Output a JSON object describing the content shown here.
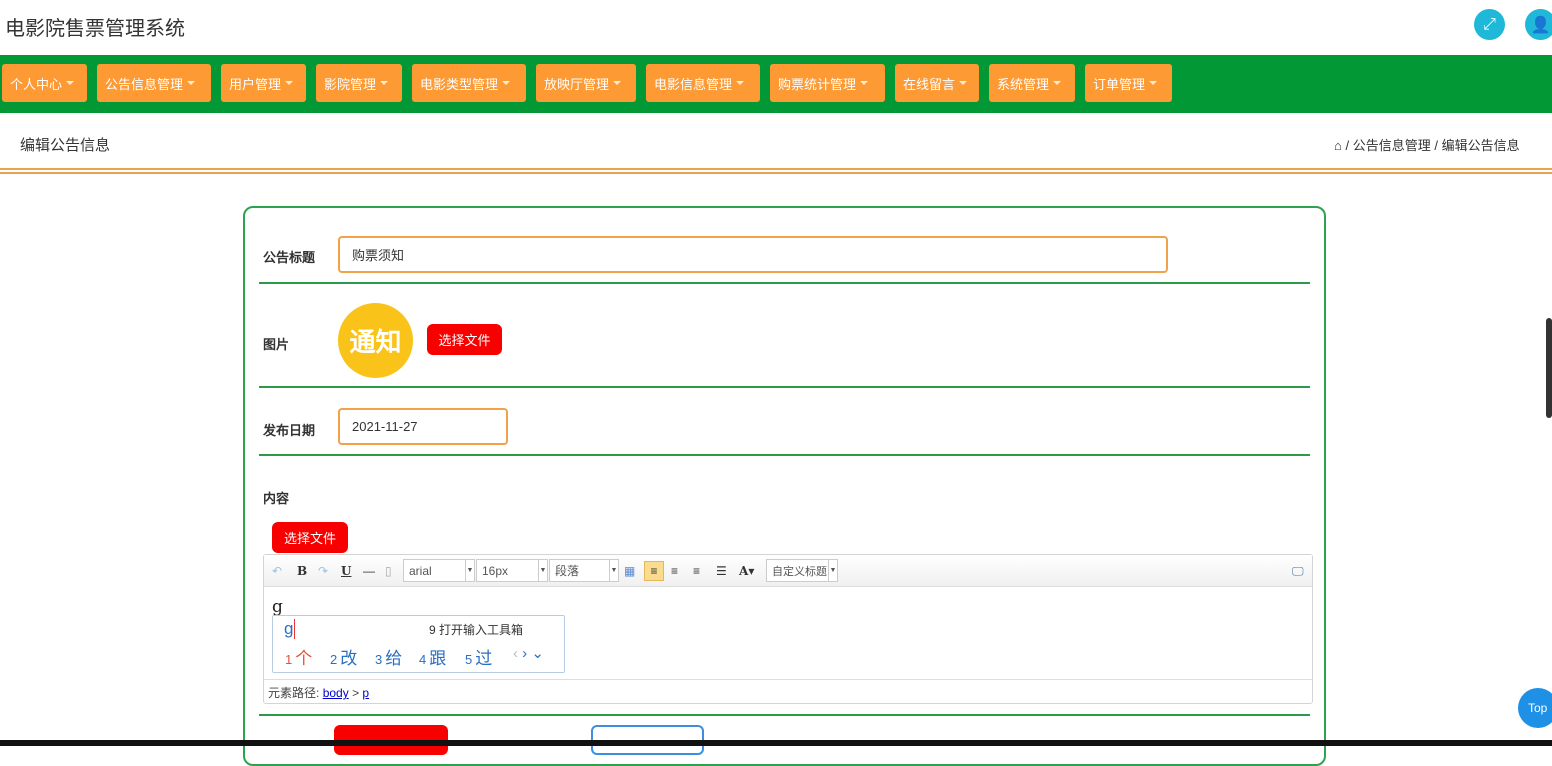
{
  "header": {
    "title": "电影院售票管理系统",
    "fullscreen_icon": "expand-icon",
    "user_icon": "user-icon"
  },
  "nav": [
    {
      "label": "个人中心"
    },
    {
      "label": "公告信息管理"
    },
    {
      "label": "用户管理"
    },
    {
      "label": "影院管理"
    },
    {
      "label": "电影类型管理"
    },
    {
      "label": "放映厅管理"
    },
    {
      "label": "电影信息管理"
    },
    {
      "label": "购票统计管理"
    },
    {
      "label": "在线留言"
    },
    {
      "label": "系统管理"
    },
    {
      "label": "订单管理"
    }
  ],
  "page": {
    "title": "编辑公告信息",
    "breadcrumb": [
      "公告信息管理",
      "编辑公告信息"
    ],
    "sep": "/"
  },
  "form": {
    "title_label": "公告标题",
    "title_value": "购票须知",
    "image_label": "图片",
    "image_text": "通知",
    "choose_file": "选择文件",
    "date_label": "发布日期",
    "date_value": "2021-11-27",
    "content_label": "内容",
    "content_choose_file": "选择文件"
  },
  "editor": {
    "font": "arial",
    "size": "16px",
    "paragraph": "段落",
    "custom_title": "自定义标题",
    "bold": "B",
    "underline": "U",
    "fontcolor": "A",
    "content": "g",
    "path_label": "元素路径:",
    "path": [
      "body",
      "p"
    ],
    "path_sep": ">"
  },
  "ime": {
    "input": "g",
    "toolbox": "9 打开输入工具箱",
    "candidates": [
      {
        "n": "1",
        "c": "个"
      },
      {
        "n": "2",
        "c": "改"
      },
      {
        "n": "3",
        "c": "给"
      },
      {
        "n": "4",
        "c": "跟"
      },
      {
        "n": "5",
        "c": "过"
      }
    ]
  },
  "top_button": "Top",
  "colors": {
    "nav": "#029835",
    "nav_button": "#fd9a34",
    "danger": "#f80000",
    "border": "#2ea34f"
  }
}
